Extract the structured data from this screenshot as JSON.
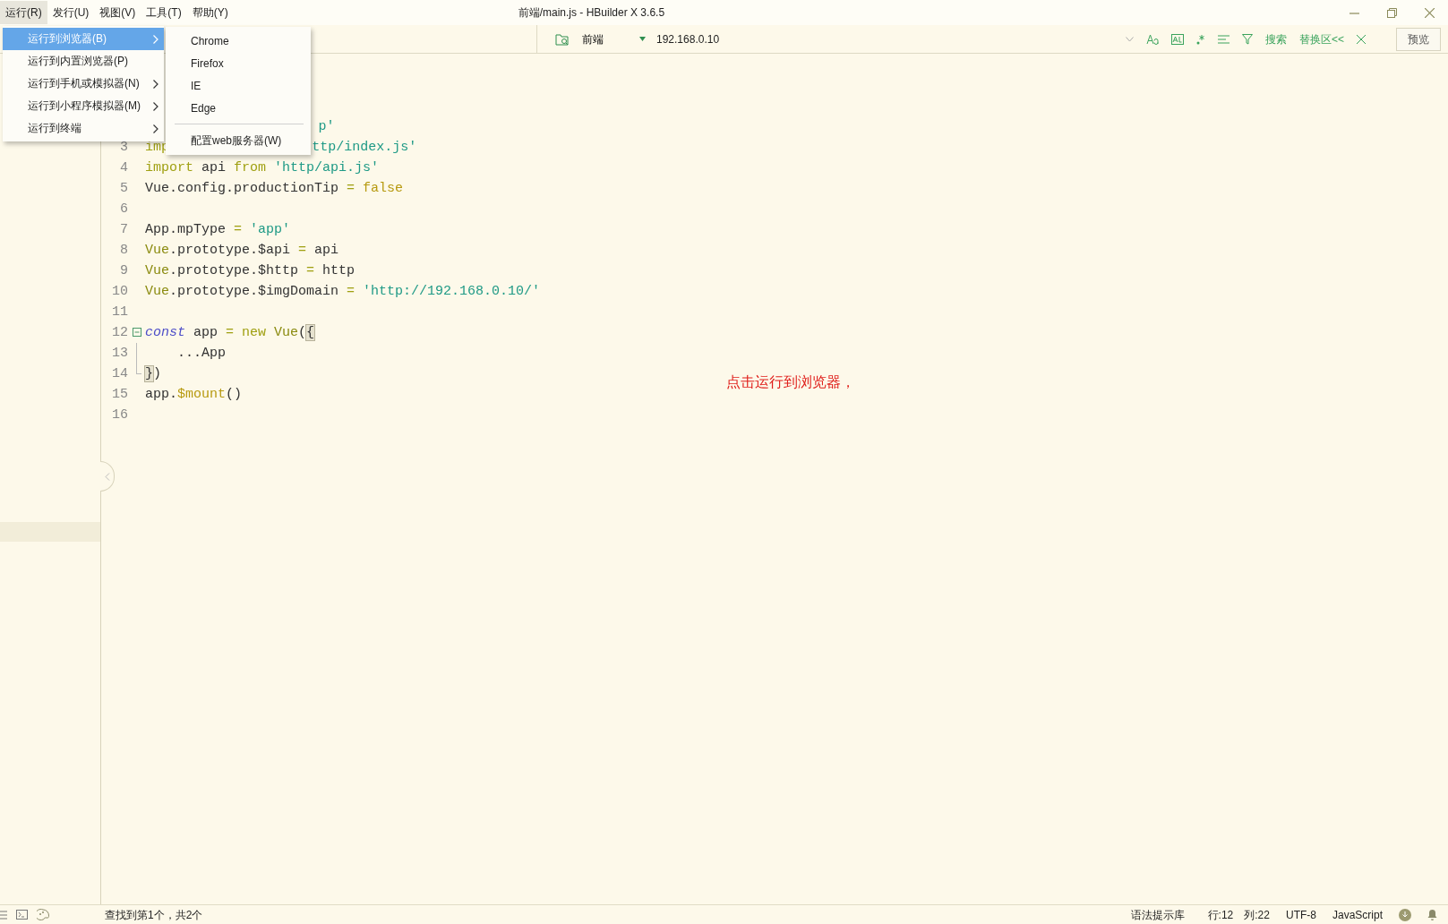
{
  "window": {
    "title": "前端/main.js - HBuilder X 3.6.5"
  },
  "menubar": [
    {
      "label": "运行(R)",
      "selected": true
    },
    {
      "label": "发行(U)",
      "selected": false
    },
    {
      "label": "视图(V)",
      "selected": false
    },
    {
      "label": "工具(T)",
      "selected": false
    },
    {
      "label": "帮助(Y)",
      "selected": false
    }
  ],
  "run_menu": [
    {
      "label": "运行到浏览器(B)",
      "selected": true,
      "submenu": true
    },
    {
      "label": "运行到内置浏览器(P)",
      "selected": false,
      "submenu": false
    },
    {
      "label": "运行到手机或模拟器(N)",
      "selected": false,
      "submenu": true
    },
    {
      "label": "运行到小程序模拟器(M)",
      "selected": false,
      "submenu": true
    },
    {
      "label": "运行到终端",
      "selected": false,
      "submenu": true
    }
  ],
  "browser_submenu": [
    {
      "label": "Chrome",
      "kind": "item"
    },
    {
      "label": "Firefox",
      "kind": "item"
    },
    {
      "label": "IE",
      "kind": "item"
    },
    {
      "label": "Edge",
      "kind": "item"
    },
    {
      "kind": "separator"
    },
    {
      "label": "配置web服务器(W)",
      "kind": "item"
    }
  ],
  "toolbar": {
    "project": "前端",
    "address": "192.168.0.10",
    "search_button": "搜索",
    "replace_toggle": "替换区<<",
    "preview_button": "预览"
  },
  "editor": {
    "lines": [
      {
        "tokens": [
          {
            "text": "p'",
            "kind": "string",
            "after_hidden": true
          }
        ]
      },
      {
        "number": "3",
        "tokens": [
          {
            "text": "imp",
            "kind": "keyword"
          },
          {
            "text": "ttp/index.js'",
            "kind": "string",
            "after_hidden": true
          }
        ]
      },
      {
        "number": "4",
        "tokens": [
          {
            "text": "import",
            "kind": "keyword"
          },
          {
            "text": " api ",
            "kind": "plain"
          },
          {
            "text": "from ",
            "kind": "keyword"
          },
          {
            "text": "'http/api.js'",
            "kind": "string"
          }
        ]
      },
      {
        "number": "5",
        "tokens": [
          {
            "text": "Vue.config.productionTip ",
            "kind": "plain"
          },
          {
            "text": "= ",
            "kind": "keyword"
          },
          {
            "text": "false",
            "kind": "constant"
          }
        ]
      },
      {
        "number": "6"
      },
      {
        "number": "7",
        "tokens": [
          {
            "text": "App.mpType ",
            "kind": "plain"
          },
          {
            "text": "= ",
            "kind": "keyword"
          },
          {
            "text": "'app'",
            "kind": "string"
          }
        ]
      },
      {
        "number": "8",
        "tokens": [
          {
            "text": "Vue",
            "kind": "class"
          },
          {
            "text": ".prototype.$api ",
            "kind": "plain"
          },
          {
            "text": "=",
            "kind": "keyword"
          },
          {
            "text": " api",
            "kind": "plain"
          }
        ]
      },
      {
        "number": "9",
        "tokens": [
          {
            "text": "Vue",
            "kind": "class"
          },
          {
            "text": ".prototype.$http ",
            "kind": "plain"
          },
          {
            "text": "=",
            "kind": "keyword"
          },
          {
            "text": " http",
            "kind": "plain"
          }
        ]
      },
      {
        "number": "10",
        "tokens": [
          {
            "text": "Vue",
            "kind": "class"
          },
          {
            "text": ".prototype.$imgDomain ",
            "kind": "plain"
          },
          {
            "text": "= ",
            "kind": "keyword"
          },
          {
            "text": "'http://192.168.0.10/'",
            "kind": "string"
          }
        ]
      },
      {
        "number": "11"
      },
      {
        "number": "12",
        "folded": false,
        "tokens": [
          {
            "text": "const",
            "kind": "storage"
          },
          {
            "text": " app ",
            "kind": "plain"
          },
          {
            "text": "= new ",
            "kind": "keyword"
          },
          {
            "text": "Vue",
            "kind": "class"
          },
          {
            "text": "(",
            "kind": "plain"
          },
          {
            "text": "{",
            "kind": "bracket-match"
          }
        ]
      },
      {
        "number": "13",
        "guide": true,
        "tokens": [
          {
            "text": "    ...App",
            "kind": "plain"
          }
        ]
      },
      {
        "number": "14",
        "guide": true,
        "tokens": [
          {
            "text": "}",
            "kind": "bracket-match"
          },
          {
            "text": ")",
            "kind": "plain"
          }
        ]
      },
      {
        "number": "15",
        "tokens": [
          {
            "text": "app.",
            "kind": "plain"
          },
          {
            "text": "$mount",
            "kind": "constant"
          },
          {
            "text": "()",
            "kind": "plain"
          }
        ]
      },
      {
        "number": "16"
      }
    ],
    "annotation": "点击运行到浏览器，"
  },
  "status_bar": {
    "find_result": "查找到第1个，共2个",
    "syntax_library": "语法提示库",
    "line": "行:12",
    "column": "列:22",
    "encoding": "UTF-8",
    "language": "JavaScript"
  }
}
